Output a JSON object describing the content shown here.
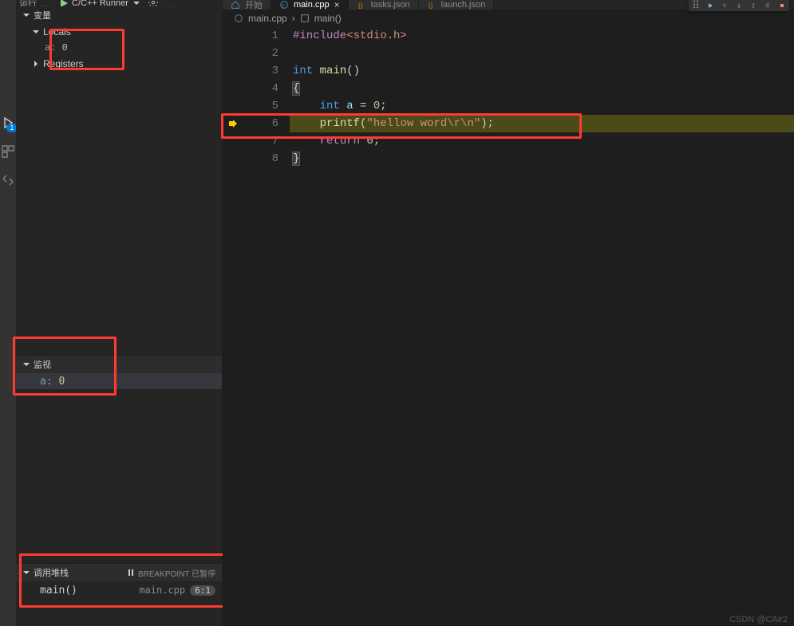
{
  "topbar": {
    "run_label": "运行",
    "config_label": "C/C++ Runner"
  },
  "sidebar": {
    "variables": {
      "title": "变量",
      "locals_label": "Locals",
      "var_name": "a:",
      "var_value": "0",
      "registers_label": "Registers"
    },
    "watch": {
      "title": "监视",
      "expr_name": "a:",
      "expr_value": "0"
    },
    "callstack": {
      "title": "调用堆栈",
      "paused_label": "BREAKPOINT 已暂停",
      "frame": "main()",
      "file": "main.cpp",
      "pos": "6:1"
    }
  },
  "tabs": {
    "items": [
      {
        "label": "开始"
      },
      {
        "label": "main.cpp"
      },
      {
        "label": "tasks.json"
      },
      {
        "label": "launch.json"
      }
    ]
  },
  "breadcrumb": {
    "file": "main.cpp",
    "symbol": "main()"
  },
  "code": {
    "lines": [
      "1",
      "2",
      "3",
      "4",
      "5",
      "6",
      "7",
      "8"
    ],
    "l1_pp": "#include",
    "l1_inc": "<stdio.h>",
    "l3_type": "int",
    "l3_fn": "main",
    "l3_paren": "()",
    "l4_brace": "{",
    "l5_type": "int",
    "l5_id": "a",
    "l5_rest": " = ",
    "l5_num": "0",
    "l5_semi": ";",
    "l6_fn": "printf",
    "l6_open": "(",
    "l6_str": "\"hellow word\\r\\n\"",
    "l6_close": ");",
    "l7_kw": "return",
    "l7_num": "0",
    "l7_semi": ";",
    "l8_brace": "}"
  },
  "watermark": "CSDN @CAir2"
}
